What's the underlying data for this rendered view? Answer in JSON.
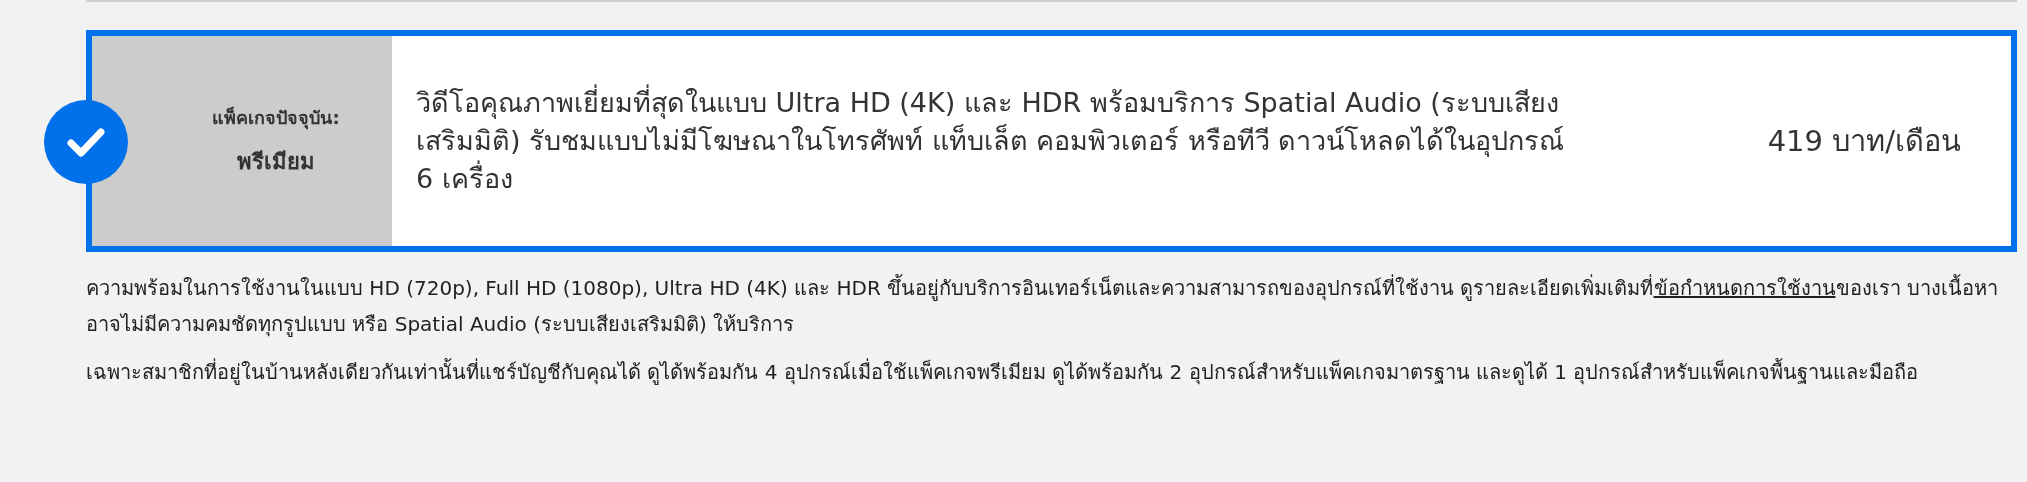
{
  "current_plan": {
    "selected": true,
    "label": "แพ็คเกจปัจจุบัน:",
    "name": "พรีเมียม",
    "description": "วิดีโอคุณภาพเยี่ยมที่สุดในแบบ Ultra HD (4K) และ HDR พร้อมบริการ Spatial Audio (ระบบเสียงเสริมมิติ) รับชมแบบไม่มีโฆษณาในโทรศัพท์ แท็บเล็ต คอมพิวเตอร์ หรือทีวี ดาวน์โหลดได้ในอุปกรณ์ 6 เครื่อง",
    "price": "419 บาท/เดือน"
  },
  "notes": [
    {
      "before": "ความพร้อมในการใช้งานในแบบ HD (720p), Full HD (1080p), Ultra HD (4K) และ HDR ขึ้นอยู่กับบริการอินเทอร์เน็ตและความสามารถของอุปกรณ์ที่ใช้งาน ดูรายละเอียดเพิ่มเติมที่",
      "link": "ข้อกำหนดการใช้งาน",
      "after": "ของเรา บางเนื้อหาอาจไม่มีความคมชัดทุกรูปแบบ หรือ Spatial Audio (ระบบเสียงเสริมมิติ) ให้บริการ"
    },
    {
      "before": "เฉพาะสมาชิกที่อยู่ในบ้านหลังเดียวกันเท่านั้นที่แชร์บัญชีกับคุณได้ ดูได้พร้อมกัน 4 อุปกรณ์เมื่อใช้แพ็คเกจพรีเมียม ดูได้พร้อมกัน 2 อุปกรณ์สำหรับแพ็คเกจมาตรฐาน และดูได้ 1 อุปกรณ์สำหรับแพ็คเกจพื้นฐานและมือถือ"
    }
  ]
}
